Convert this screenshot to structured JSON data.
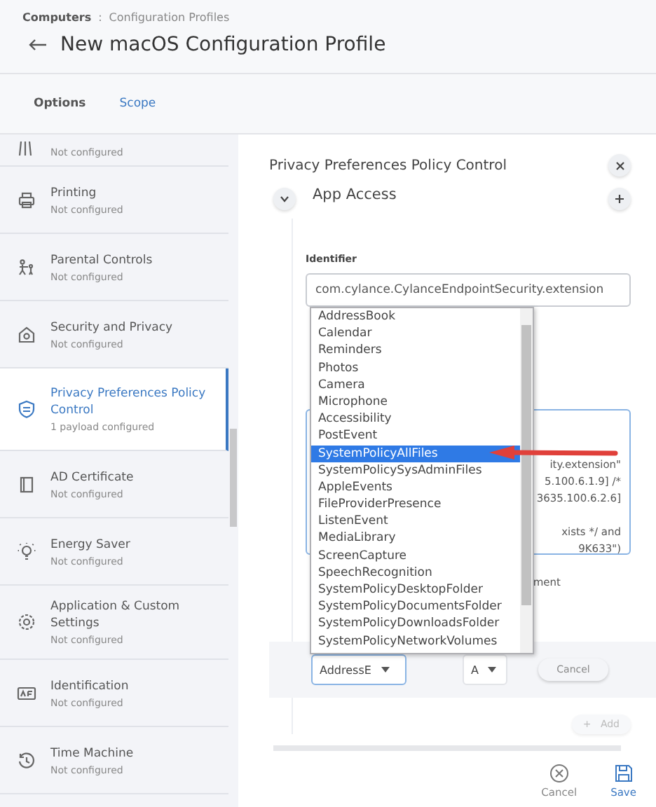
{
  "breadcrumb": {
    "parent": "Computers",
    "separator": ":",
    "current": "Configuration Profiles"
  },
  "title": "New macOS Configuration Profile",
  "tabs": [
    {
      "label": "Options",
      "selected": true
    },
    {
      "label": "Scope",
      "selected": false
    }
  ],
  "sidebar": {
    "items": [
      {
        "kind": "mobility",
        "subtitle": "Not configured",
        "selected": false
      },
      {
        "kind": "printer",
        "title": "Printing",
        "subtitle": "Not configured",
        "selected": false
      },
      {
        "kind": "parental",
        "title": "Parental Controls",
        "subtitle": "Not configured",
        "selected": false
      },
      {
        "kind": "house",
        "title": "Security and Privacy",
        "subtitle": "Not configured",
        "selected": false
      },
      {
        "kind": "shield",
        "title": "Privacy Preferences Policy Control",
        "subtitle": "1 payload configured",
        "selected": true
      },
      {
        "kind": "certificate",
        "title": "AD Certificate",
        "subtitle": "Not configured",
        "selected": false
      },
      {
        "kind": "bulb",
        "title": "Energy Saver",
        "subtitle": "Not configured",
        "selected": false
      },
      {
        "kind": "gear",
        "title": "Application & Custom Settings",
        "subtitle": "Not configured",
        "selected": false
      },
      {
        "kind": "idcard",
        "title": "Identification",
        "subtitle": "Not configured",
        "selected": false
      },
      {
        "kind": "clock",
        "title": "Time Machine",
        "subtitle": "Not configured",
        "selected": false
      }
    ]
  },
  "panel": {
    "title": "Privacy Preferences Policy Control",
    "section": {
      "title": "App Access",
      "expanded": true
    },
    "identifier": {
      "label": "Identifier",
      "value": "com.cylance.CylanceEndpointSecurity.extension"
    },
    "code_fragments": [
      "ity.extension\"",
      "5.100.6.1.9] /*",
      "3635.100.6.2.6]",
      "xists */ and",
      "9K633\")"
    ],
    "checkbox_fragment": "ment",
    "dropdown": {
      "options": [
        {
          "label": "AddressBook",
          "selected": false
        },
        {
          "label": "Calendar",
          "selected": false
        },
        {
          "label": "Reminders",
          "selected": false
        },
        {
          "label": "Photos",
          "selected": false
        },
        {
          "label": "Camera",
          "selected": false
        },
        {
          "label": "Microphone",
          "selected": false
        },
        {
          "label": "Accessibility",
          "selected": false
        },
        {
          "label": "PostEvent",
          "selected": false
        },
        {
          "label": "SystemPolicyAllFiles",
          "selected": true
        },
        {
          "label": "SystemPolicySysAdminFiles",
          "selected": false
        },
        {
          "label": "AppleEvents",
          "selected": false
        },
        {
          "label": "FileProviderPresence",
          "selected": false
        },
        {
          "label": "ListenEvent",
          "selected": false
        },
        {
          "label": "MediaLibrary",
          "selected": false
        },
        {
          "label": "ScreenCapture",
          "selected": false
        },
        {
          "label": "SpeechRecognition",
          "selected": false
        },
        {
          "label": "SystemPolicyDesktopFolder",
          "selected": false
        },
        {
          "label": "SystemPolicyDocumentsFolder",
          "selected": false
        },
        {
          "label": "SystemPolicyDownloadsFolder",
          "selected": false
        },
        {
          "label": "SystemPolicyNetworkVolumes",
          "selected": false
        }
      ]
    },
    "service_select": "AddressE",
    "access_select": "A",
    "cancel_button": "Cancel",
    "add_button": {
      "icon": "+",
      "label": "Add",
      "disabled": true
    }
  },
  "footer": {
    "cancel": "Cancel",
    "save": "Save"
  }
}
